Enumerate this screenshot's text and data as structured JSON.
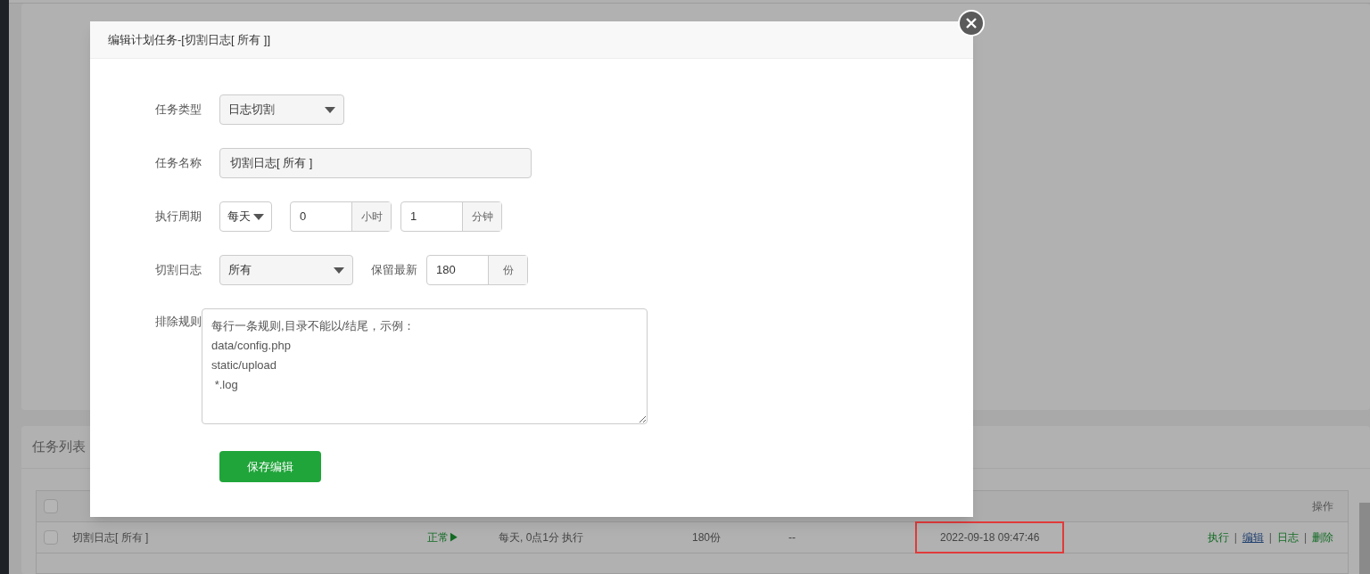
{
  "dialog": {
    "title": "编辑计划任务-[切割日志[ 所有 ]]",
    "task_type": {
      "label": "任务类型",
      "value": "日志切割"
    },
    "task_name": {
      "label": "任务名称",
      "value": "切割日志[ 所有 ]"
    },
    "period": {
      "label": "执行周期",
      "cycle": "每天",
      "hour": "0",
      "hour_unit": "小时",
      "minute": "1",
      "minute_unit": "分钟"
    },
    "cut_log": {
      "label": "切割日志",
      "value": "所有",
      "keep_label": "保留最新",
      "keep": "180",
      "keep_unit": "份"
    },
    "exclude": {
      "label": "排除规则",
      "value": "每行一条规则,目录不能以/结尾，示例：\ndata/config.php\nstatic/upload\n *.log"
    },
    "save_button": "保存编辑"
  },
  "task_list": {
    "title": "任务列表",
    "header_checked": false,
    "actions_header": "操作",
    "action_separator": "|",
    "rows": [
      {
        "checked": false,
        "name": "切割日志[ 所有 ]",
        "status": "正常",
        "status_icon": "▶",
        "period": "每天, 0点1分 执行",
        "count": "180份",
        "backup": "--",
        "last_run": "2022-09-18 09:47:46",
        "last_run_outlined": true,
        "actions": [
          {
            "label": "执行",
            "underlined": false
          },
          {
            "label": "编辑",
            "underlined": true
          },
          {
            "label": "日志",
            "underlined": false
          },
          {
            "label": "删除",
            "underlined": false
          }
        ]
      }
    ]
  }
}
